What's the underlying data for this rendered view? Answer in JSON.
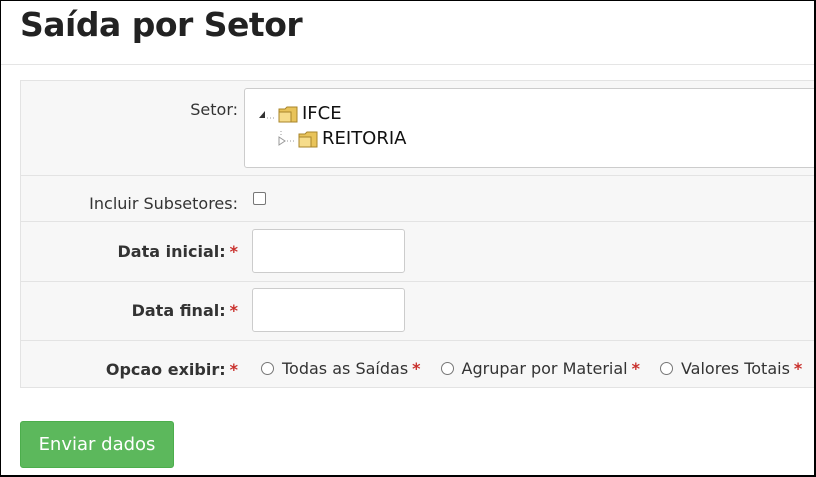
{
  "page": {
    "title": "Saída por Setor"
  },
  "form": {
    "setor": {
      "label": "Setor:",
      "tree": [
        {
          "label": "IFCE",
          "icon": "folder-icon",
          "expanded": true
        },
        {
          "label": "REITORIA",
          "icon": "folder-icon",
          "expanded": false
        }
      ]
    },
    "incluir_subsetores": {
      "label": "Incluir Subsetores:",
      "checked": false
    },
    "data_inicial": {
      "label": "Data inicial:",
      "required_mark": "*",
      "value": ""
    },
    "data_final": {
      "label": "Data final:",
      "required_mark": "*",
      "value": ""
    },
    "opcao_exibir": {
      "label": "Opcao exibir:",
      "required_mark": "*",
      "options": [
        {
          "label": "Todas as Saídas",
          "required_mark": "*",
          "selected": false
        },
        {
          "label": "Agrupar por Material",
          "required_mark": "*",
          "selected": false
        },
        {
          "label": "Valores Totais",
          "required_mark": "*",
          "selected": false
        }
      ]
    },
    "submit_label": "Enviar dados"
  },
  "colors": {
    "primary_button": "#5cb85c",
    "required": "#c9302c"
  }
}
